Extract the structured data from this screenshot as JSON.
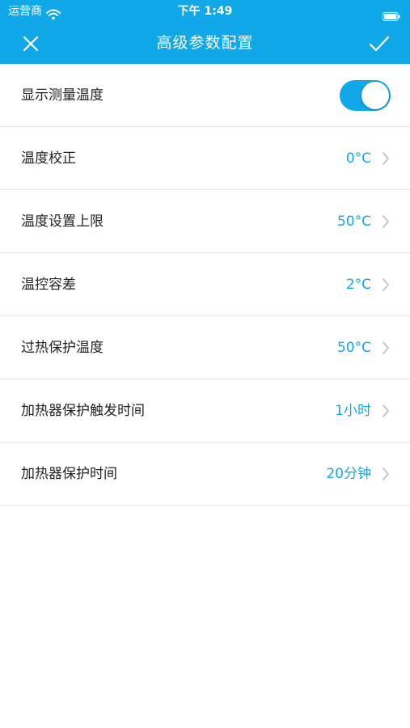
{
  "status_bar": {
    "carrier": "运营商",
    "time": "下午 1:49",
    "icons": [
      "wifi-icon",
      "battery-icon"
    ]
  },
  "nav": {
    "title": "高级参数配置",
    "close_icon": "close-icon",
    "confirm_icon": "check-icon"
  },
  "colors": {
    "accent": "#10a8e8",
    "label_text": "#222222",
    "divider": "#e3e3e3",
    "background": "#ffffff"
  },
  "settings": [
    {
      "label": "显示测量温度",
      "type": "toggle",
      "enabled": true
    },
    {
      "label": "温度校正",
      "value": "0°C"
    },
    {
      "label": "温度设置上限",
      "value": "50°C"
    },
    {
      "label": "温控容差",
      "value": "2°C"
    },
    {
      "label": "过热保护温度",
      "value": "50°C"
    },
    {
      "label": "加热器保护触发时间",
      "value": "1小时"
    },
    {
      "label": "加热器保护时间",
      "value": "20分钟"
    }
  ]
}
